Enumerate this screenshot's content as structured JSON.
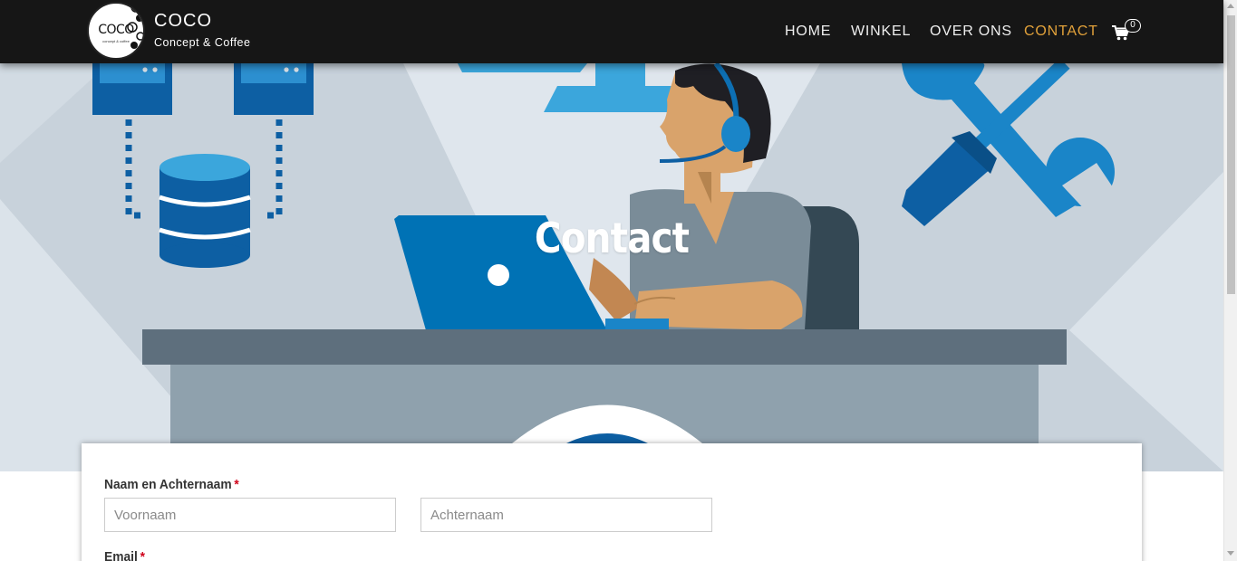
{
  "brand": {
    "logo_text": "COCO",
    "logo_subtext": "concept & coffee",
    "name": "COCO",
    "tagline": "Concept & Coffee"
  },
  "nav": {
    "items": [
      {
        "label": "HOME",
        "active": false
      },
      {
        "label": "WINKEL",
        "active": false
      },
      {
        "label": "OVER ONS",
        "active": false
      },
      {
        "label": "CONTACT",
        "active": true
      }
    ],
    "cart_count": "0"
  },
  "hero": {
    "title": "Contact"
  },
  "form": {
    "name_label": "Naam en Achternaam",
    "required_mark": "*",
    "first_name_placeholder": "Voornaam",
    "last_name_placeholder": "Achternaam",
    "first_name_value": "",
    "last_name_value": "",
    "email_label": "Email"
  },
  "colors": {
    "navbar": "#161616",
    "active_nav": "#e1a13a",
    "hero_blue": "#0072b5",
    "required": "#d0021b"
  }
}
